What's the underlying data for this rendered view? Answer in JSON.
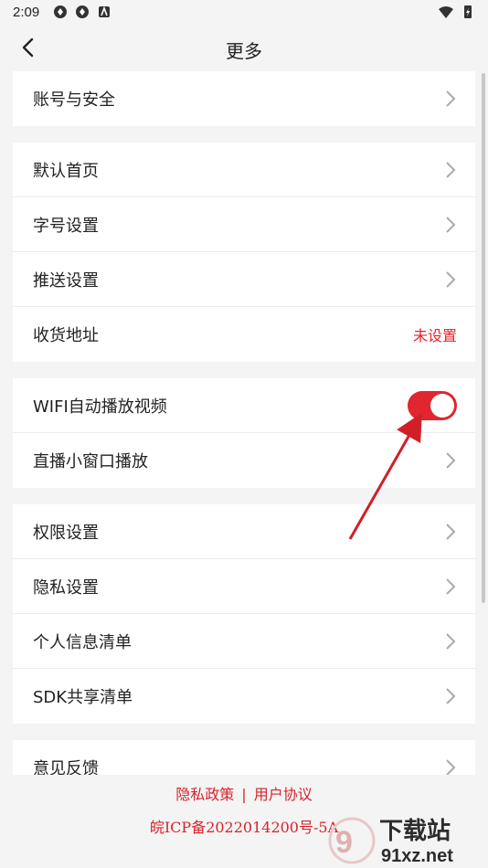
{
  "status_bar": {
    "time": "2:09"
  },
  "header": {
    "title": "更多"
  },
  "groups": [
    [
      {
        "label": "账号与安全",
        "type": "chevron"
      }
    ],
    [
      {
        "label": "默认首页",
        "type": "chevron"
      },
      {
        "label": "字号设置",
        "type": "chevron"
      },
      {
        "label": "推送设置",
        "type": "chevron"
      },
      {
        "label": "收货地址",
        "type": "value",
        "value": "未设置"
      }
    ],
    [
      {
        "label": "WIFI自动播放视频",
        "type": "toggle",
        "on": true
      },
      {
        "label": "直播小窗口播放",
        "type": "chevron"
      }
    ],
    [
      {
        "label": "权限设置",
        "type": "chevron"
      },
      {
        "label": "隐私设置",
        "type": "chevron"
      },
      {
        "label": "个人信息清单",
        "type": "chevron"
      },
      {
        "label": "SDK共享清单",
        "type": "chevron"
      }
    ],
    [
      {
        "label": "意见反馈",
        "type": "chevron"
      }
    ]
  ],
  "footer": {
    "privacy_link": "隐私政策",
    "separator": "|",
    "agreement_link": "用户协议",
    "icp": "皖ICP备2022014200号-5A"
  },
  "watermark": {
    "text1": "下载站",
    "text2": "91xz.net"
  },
  "colors": {
    "accent": "#e0262f",
    "background": "#f4f4f4"
  }
}
